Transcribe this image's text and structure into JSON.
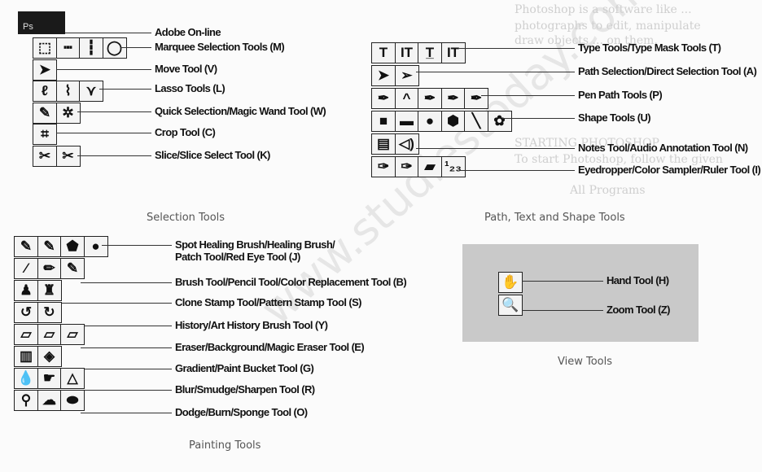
{
  "watermark": "www.studiestoday.com",
  "bleed_text": [
    "Photoshop is a software like ...",
    "photographs to edit, manipulate",
    "draw objects ... on them.",
    "STARTING PHOTOSHOP",
    "To start Photoshop, follow the given",
    "All Programs"
  ],
  "logo": {
    "text": "Ps",
    "label": "Adobe On-line"
  },
  "selection": {
    "caption": "Selection Tools",
    "rows": [
      {
        "icons": [
          "rect-marquee",
          "row-marquee",
          "col-marquee",
          "ellipse-marquee"
        ],
        "label": "Marquee Selection Tools (M)"
      },
      {
        "icons": [
          "move"
        ],
        "label": "Move Tool (V)"
      },
      {
        "icons": [
          "lasso",
          "polygon-lasso",
          "magnetic-lasso"
        ],
        "label": "Lasso Tools (L)"
      },
      {
        "icons": [
          "quick-selection",
          "magic-wand"
        ],
        "label": "Quick Selection/Magic Wand Tool (W)"
      },
      {
        "icons": [
          "crop"
        ],
        "label": "Crop Tool (C)"
      },
      {
        "icons": [
          "slice",
          "slice-select"
        ],
        "label": "Slice/Slice Select Tool (K)"
      }
    ]
  },
  "path": {
    "caption": "Path, Text and Shape Tools",
    "rows": [
      {
        "icons": [
          "type",
          "vertical-type",
          "type-mask",
          "vertical-type-mask"
        ],
        "label": "Type Tools/Type Mask Tools (T)"
      },
      {
        "icons": [
          "path-selection",
          "direct-selection"
        ],
        "label": "Path Selection/Direct Selection Tool (A)"
      },
      {
        "icons": [
          "pen",
          "convert-point",
          "delete-anchor",
          "add-anchor",
          "freeform-pen"
        ],
        "label": "Pen Path Tools (P)"
      },
      {
        "icons": [
          "rectangle",
          "rounded-rectangle",
          "ellipse",
          "polygon",
          "line",
          "custom-shape"
        ],
        "label": "Shape Tools (U)"
      },
      {
        "icons": [
          "notes",
          "audio-annotation"
        ],
        "label": "Notes Tool/Audio Annotation Tool (N)"
      },
      {
        "icons": [
          "eyedropper",
          "color-sampler",
          "ruler",
          "count"
        ],
        "label": "Eyedropper/Color Sampler/Ruler Tool (I)"
      }
    ]
  },
  "painting": {
    "caption": "Painting Tools",
    "rows": [
      {
        "icons": [
          "spot-healing",
          "healing-brush",
          "patch",
          "red-eye"
        ],
        "label": "Spot Healing Brush/Healing Brush/",
        "label2": "Patch Tool/Red Eye Tool (J)"
      },
      {
        "icons": [
          "brush",
          "pencil",
          "color-replacement"
        ],
        "label": "Brush Tool/Pencil Tool/Color Replacement Tool (B)"
      },
      {
        "icons": [
          "clone-stamp",
          "pattern-stamp"
        ],
        "label": "Clone Stamp Tool/Pattern Stamp Tool (S)"
      },
      {
        "icons": [
          "history-brush",
          "art-history-brush"
        ],
        "label": "History/Art History Brush Tool (Y)"
      },
      {
        "icons": [
          "eraser",
          "background-eraser",
          "magic-eraser"
        ],
        "label": "Eraser/Background/Magic Eraser Tool (E)"
      },
      {
        "icons": [
          "gradient",
          "paint-bucket"
        ],
        "label": "Gradient/Paint Bucket Tool (G)"
      },
      {
        "icons": [
          "blur",
          "smudge",
          "sharpen"
        ],
        "label": "Blur/Smudge/Sharpen Tool (R)"
      },
      {
        "icons": [
          "dodge",
          "burn",
          "sponge"
        ],
        "label": "Dodge/Burn/Sponge Tool (O)"
      }
    ]
  },
  "view": {
    "caption": "View Tools",
    "rows": [
      {
        "icons": [
          "hand"
        ],
        "label": "Hand Tool (H)"
      },
      {
        "icons": [
          "zoom"
        ],
        "label": "Zoom Tool (Z)"
      }
    ]
  }
}
